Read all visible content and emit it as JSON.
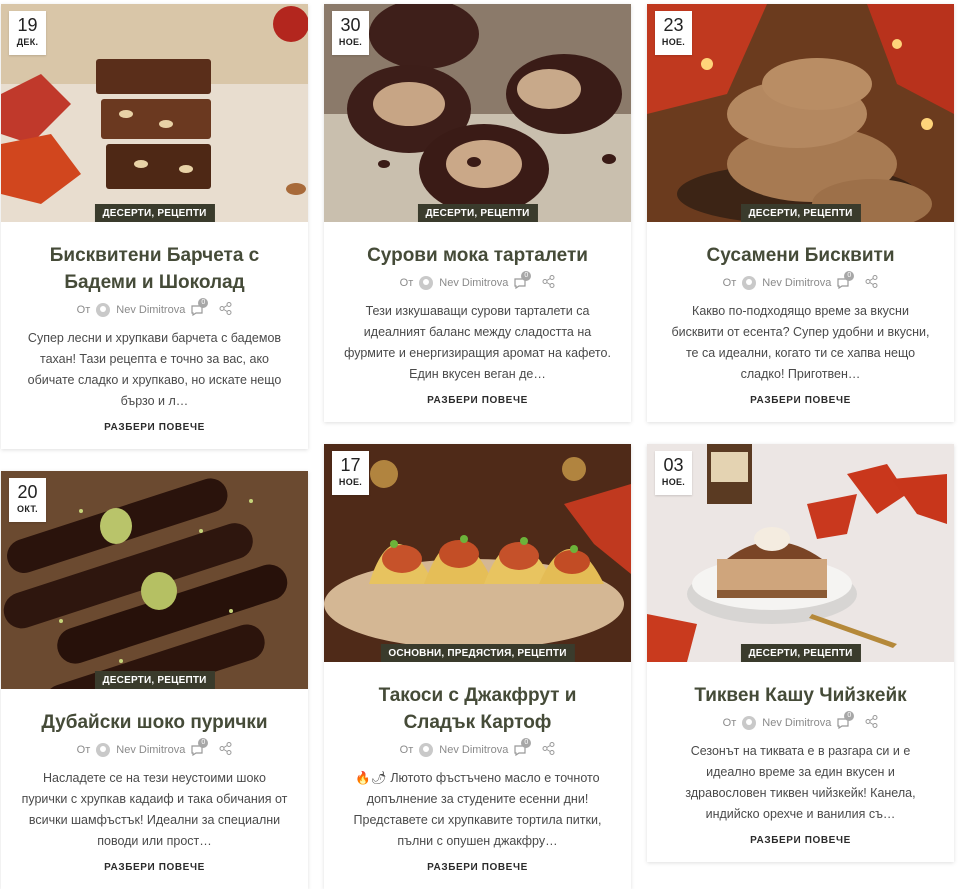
{
  "posts": [
    {
      "day": "19",
      "month": "ДЕК.",
      "categories": "ДЕСЕРТИ, РЕЦЕПТИ",
      "title": "Бисквитени Барчета с Бадеми и Шоколад",
      "by": "От",
      "author": "Nev Dimitrova",
      "comments": "0",
      "excerpt": "Супер лесни и хрупкави барчета с бадемов тахан! Тази рецепта е точно за вас, ако обичате сладко и хрупкаво, но искате нещо бързо и л…",
      "more": "РАЗБЕРИ ПОВЕЧЕ"
    },
    {
      "day": "30",
      "month": "НОЕ.",
      "categories": "ДЕСЕРТИ, РЕЦЕПТИ",
      "title": "Сурови мока тарталети",
      "by": "От",
      "author": "Nev Dimitrova",
      "comments": "0",
      "excerpt": "Тези изкушаващи сурови тарталети са идеалният баланс между сладостта на фурмите и енергизиращия аромат на кафето. Един вкусен веган де…",
      "more": "РАЗБЕРИ ПОВЕЧЕ"
    },
    {
      "day": "23",
      "month": "НОЕ.",
      "categories": "ДЕСЕРТИ, РЕЦЕПТИ",
      "title": "Сусамени Бисквити",
      "by": "От",
      "author": "Nev Dimitrova",
      "comments": "0",
      "excerpt": "Какво по-подходящо време за вкусни бисквити от есента? Супер удобни и вкусни, те са идеални, когато ти се хапва нещо сладко! Приготвен…",
      "more": "РАЗБЕРИ ПОВЕЧЕ"
    },
    {
      "day": "20",
      "month": "ОКТ.",
      "categories": "ДЕСЕРТИ, РЕЦЕПТИ",
      "title": "Дубайски шоко пурички",
      "by": "От",
      "author": "Nev Dimitrova",
      "comments": "0",
      "excerpt": "Насладете се на тези неустоими шоко пурички с хрупкав кадаиф и така обичания от всички шамфъстък! Идеални за специални поводи или прост…",
      "more": "РАЗБЕРИ ПОВЕЧЕ"
    },
    {
      "day": "17",
      "month": "НОЕ.",
      "categories": "ОСНОВНИ, ПРЕДЯСТИЯ, РЕЦЕПТИ",
      "title": "Такоси с Джакфрут и Сладък Картоф",
      "by": "От",
      "author": "Nev Dimitrova",
      "comments": "0",
      "excerpt": "🔥🌶 Лютото фъстъчено масло е точното допълнение за студените есенни дни! Представете си хрупкавите тортила питки, пълни с опушен джакфру…",
      "more": "РАЗБЕРИ ПОВЕЧЕ"
    },
    {
      "day": "03",
      "month": "НОЕ.",
      "categories": "ДЕСЕРТИ, РЕЦЕПТИ",
      "title": "Тиквен Кашу Чийзкейк",
      "by": "От",
      "author": "Nev Dimitrova",
      "comments": "0",
      "excerpt": "Сезонът на тиквата е в разгара си и е идеално време за един вкусен и здравословен тиквен чийзкейк! Канела, индийско орехче и ванилия съ…",
      "more": "РАЗБЕРИ ПОВЕЧЕ"
    }
  ],
  "colors": {
    "title": "#454b38",
    "badge": "#3a3b2c",
    "accent": "#c0392b"
  },
  "icons": [
    "user-icon",
    "comment-icon",
    "share-icon"
  ]
}
